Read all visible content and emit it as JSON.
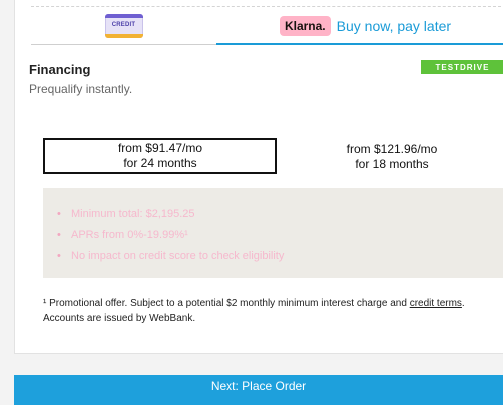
{
  "tabs": {
    "credit": {
      "card_label": "CREDIT"
    },
    "klarna": {
      "logo": "Klarna.",
      "label": "Buy now, pay later"
    }
  },
  "financing": {
    "title": "Financing",
    "subtitle": "Prequalify instantly.",
    "promo_code": "TESTDRIVE"
  },
  "plans": [
    {
      "line1": "from $91.47/mo",
      "line2": "for 24 months",
      "selected": true
    },
    {
      "line1": "from $121.96/mo",
      "line2": "for 18 months",
      "selected": false
    }
  ],
  "details": [
    "Minimum total: $2,195.25",
    "APRs from 0%-19.99%¹",
    "No impact on credit score to check eligibility"
  ],
  "footnote": {
    "text_before": "¹ Promotional offer. Subject to a potential $2 monthly minimum interest charge and ",
    "link1": "credit terms",
    "text_after": ". Accounts are issued by WebBank."
  },
  "actions": {
    "next_label": "Next: Place Order"
  },
  "colors": {
    "accent": "#1ea0dc",
    "klarna_pink": "#ffb3c7",
    "promo_green": "#5ec23a",
    "muted_pink": "#f6b8cd"
  },
  "icons": [
    "credit-card-icon",
    "bullet-icon"
  ]
}
